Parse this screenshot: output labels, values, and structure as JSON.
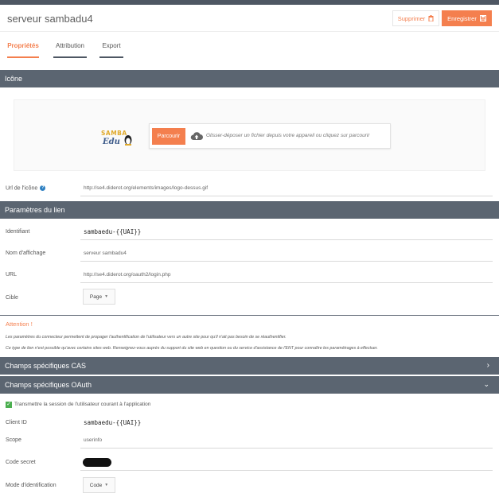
{
  "header": {
    "title": "serveur sambadu4",
    "delete_label": "Supprimer",
    "save_label": "Enregistrer"
  },
  "tabs": [
    {
      "label": "Propriétés",
      "active": true
    },
    {
      "label": "Attribution",
      "active": false
    },
    {
      "label": "Export",
      "active": false
    }
  ],
  "sections": {
    "icon": "Icône",
    "link_params": "Paramètres du lien",
    "cas": "Champs spécifiques CAS",
    "oauth": "Champs spécifiques OAuth"
  },
  "upload": {
    "browse_label": "Parcourir",
    "drop_text": "Glisser-déposer un fichier depuis votre appareil ou cliquez sur parcourir"
  },
  "icon_url": {
    "label": "Url de l'icône",
    "value": "http://se4.diderot.org/elements/images/logo-dessus.gif"
  },
  "link": {
    "identifiant_label": "Identifiant",
    "identifiant_value": "sambaedu-{{UAI}}",
    "display_name_label": "Nom d'affichage",
    "display_name_value": "serveur sambadu4",
    "url_label": "URL",
    "url_value": "http://se4.diderot.org/oauth2/login.php",
    "target_label": "Cible",
    "target_value": "Page"
  },
  "attention": {
    "title": "Attention !",
    "line1": "Les paramètres du connecteur permettent de propager l'authentification de l'utilisateur vers un autre site pour qu'il n'ait pas besoin de se réauthentifier.",
    "line2": "Ce type de lien n'est possible qu'avec certains sites web. Renseignez-vous auprès du support du site web en question ou du service d'assistance de l'ENT pour connaître les paramétrages à effectuer."
  },
  "oauth": {
    "transmit_label": "Transmettre la session de l'utilisateur courant à l'application",
    "transmit_checked": true,
    "client_id_label": "Client ID",
    "client_id_value": "sambaedu-{{UAI}}",
    "scope_label": "Scope",
    "scope_value": "userinfo",
    "secret_label": "Code secret",
    "mode_label": "Mode d'identification",
    "mode_value": "Code"
  },
  "logo": {
    "line1": "SAMBA",
    "line2": "Edu"
  },
  "colors": {
    "accent": "#f47f4e",
    "section_bar": "#5b6571",
    "top_bar": "#4e5763",
    "help": "#2d7fc1",
    "check": "#4caf50"
  }
}
